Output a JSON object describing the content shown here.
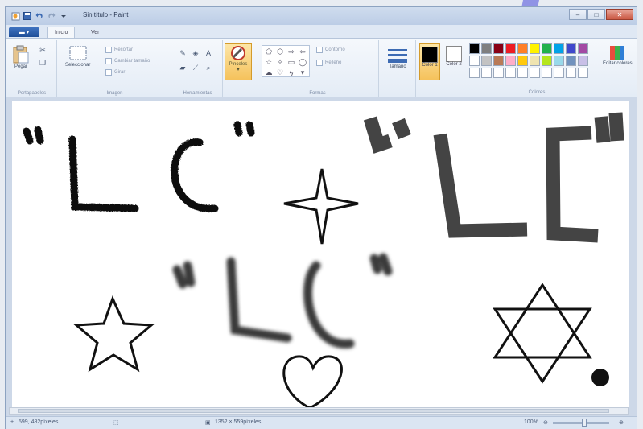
{
  "window": {
    "title": "Sin título - Paint",
    "minimize_icon": "minimize-icon",
    "maximize_icon": "maximize-icon",
    "close_icon": "close-icon"
  },
  "quick_access": [
    "paint-app-icon",
    "save-icon",
    "undo-icon",
    "redo-icon",
    "customize-icon"
  ],
  "tabs": {
    "menu_label": "",
    "items": [
      {
        "label": "Inicio",
        "active": true
      },
      {
        "label": "Ver",
        "active": false
      }
    ]
  },
  "ribbon": {
    "clipboard": {
      "label": "Portapapeles",
      "paste": "Pegar"
    },
    "image": {
      "label": "Imagen",
      "select": "Seleccionar",
      "crop": "Recortar",
      "resize": "Cambiar tamaño",
      "rotate": "Girar"
    },
    "tools": {
      "label": "Herramientas"
    },
    "brushes": {
      "label": "Pinceles"
    },
    "shapes": {
      "label": "Formas",
      "outline": "Contorno",
      "fill": "Relleno"
    },
    "size": {
      "label": "Tamaño"
    },
    "colors": {
      "label": "Colores",
      "color1": "Color 1",
      "color2": "Color 2",
      "edit": "Editar colores",
      "color1_value": "#000000",
      "color2_value": "#ffffff",
      "palette": [
        "#000000",
        "#7f7f7f",
        "#880015",
        "#ed1c24",
        "#ff7f27",
        "#fff200",
        "#22b14c",
        "#00a2e8",
        "#3f48cc",
        "#a349a4",
        "#ffffff",
        "#c3c3c3",
        "#b97a57",
        "#ffaec9",
        "#ffc90e",
        "#efe4b0",
        "#b5e61d",
        "#99d9ea",
        "#7092be",
        "#c8bfe7",
        "#ffffff",
        "#ffffff",
        "#ffffff",
        "#ffffff",
        "#ffffff",
        "#ffffff",
        "#ffffff",
        "#ffffff",
        "#ffffff",
        "#ffffff"
      ]
    }
  },
  "canvas": {
    "text_marks": {
      "open_quote": "“",
      "close_quote": "”",
      "letter_l": "L",
      "letter_c": "C"
    }
  },
  "status": {
    "cursor_position": "599, 482píxeles",
    "canvas_size": "1352 × 559píxeles",
    "zoom": "100%"
  }
}
